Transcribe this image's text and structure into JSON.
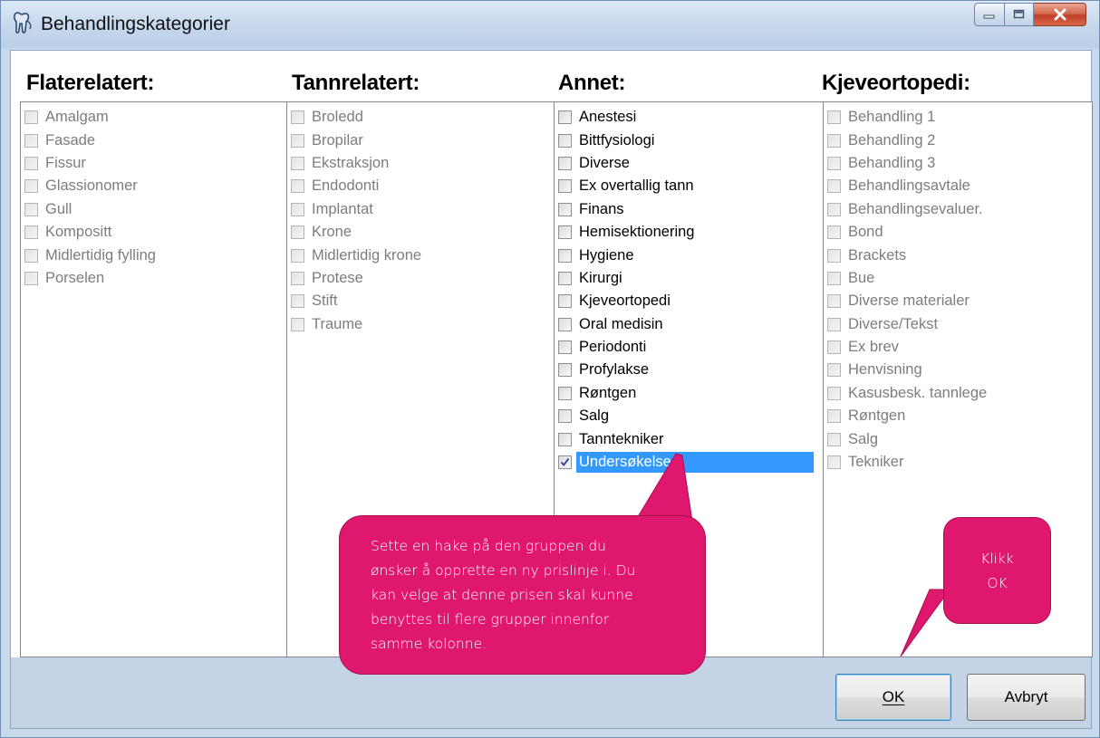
{
  "window": {
    "title": "Behandlingskategorier",
    "min_icon": "minimize-icon",
    "max_icon": "maximize-icon",
    "close_icon": "close-icon"
  },
  "columns": [
    {
      "header": "Flaterelatert:",
      "items": [
        {
          "label": "Amalgam",
          "checked": false,
          "enabled": false
        },
        {
          "label": "Fasade",
          "checked": false,
          "enabled": false
        },
        {
          "label": "Fissur",
          "checked": false,
          "enabled": false
        },
        {
          "label": "Glassionomer",
          "checked": false,
          "enabled": false
        },
        {
          "label": "Gull",
          "checked": false,
          "enabled": false
        },
        {
          "label": "Kompositt",
          "checked": false,
          "enabled": false
        },
        {
          "label": "Midlertidig fylling",
          "checked": false,
          "enabled": false
        },
        {
          "label": "Porselen",
          "checked": false,
          "enabled": false
        }
      ]
    },
    {
      "header": "Tannrelatert:",
      "items": [
        {
          "label": "Broledd",
          "checked": false,
          "enabled": false
        },
        {
          "label": "Bropilar",
          "checked": false,
          "enabled": false
        },
        {
          "label": "Ekstraksjon",
          "checked": false,
          "enabled": false
        },
        {
          "label": "Endodonti",
          "checked": false,
          "enabled": false
        },
        {
          "label": "Implantat",
          "checked": false,
          "enabled": false
        },
        {
          "label": "Krone",
          "checked": false,
          "enabled": false
        },
        {
          "label": "Midlertidig krone",
          "checked": false,
          "enabled": false
        },
        {
          "label": "Protese",
          "checked": false,
          "enabled": false
        },
        {
          "label": "Stift",
          "checked": false,
          "enabled": false
        },
        {
          "label": "Traume",
          "checked": false,
          "enabled": false
        }
      ]
    },
    {
      "header": "Annet:",
      "items": [
        {
          "label": "Anestesi",
          "checked": false,
          "enabled": true
        },
        {
          "label": "Bittfysiologi",
          "checked": false,
          "enabled": true
        },
        {
          "label": "Diverse",
          "checked": false,
          "enabled": true
        },
        {
          "label": "Ex overtallig tann",
          "checked": false,
          "enabled": true
        },
        {
          "label": "Finans",
          "checked": false,
          "enabled": true
        },
        {
          "label": "Hemisektionering",
          "checked": false,
          "enabled": true
        },
        {
          "label": "Hygiene",
          "checked": false,
          "enabled": true
        },
        {
          "label": "Kirurgi",
          "checked": false,
          "enabled": true
        },
        {
          "label": "Kjeveortopedi",
          "checked": false,
          "enabled": true
        },
        {
          "label": "Oral medisin",
          "checked": false,
          "enabled": true
        },
        {
          "label": "Periodonti",
          "checked": false,
          "enabled": true
        },
        {
          "label": "Profylakse",
          "checked": false,
          "enabled": true
        },
        {
          "label": "Røntgen",
          "checked": false,
          "enabled": true
        },
        {
          "label": "Salg",
          "checked": false,
          "enabled": true
        },
        {
          "label": "Tanntekniker",
          "checked": false,
          "enabled": true
        },
        {
          "label": "Undersøkelse",
          "checked": true,
          "enabled": true,
          "selected": true
        }
      ]
    },
    {
      "header": "Kjeveortopedi:",
      "items": [
        {
          "label": "Behandling 1",
          "checked": false,
          "enabled": false
        },
        {
          "label": "Behandling 2",
          "checked": false,
          "enabled": false
        },
        {
          "label": "Behandling 3",
          "checked": false,
          "enabled": false
        },
        {
          "label": "Behandlingsavtale",
          "checked": false,
          "enabled": false
        },
        {
          "label": "Behandlingsevaluer.",
          "checked": false,
          "enabled": false
        },
        {
          "label": "Bond",
          "checked": false,
          "enabled": false
        },
        {
          "label": "Brackets",
          "checked": false,
          "enabled": false
        },
        {
          "label": "Bue",
          "checked": false,
          "enabled": false
        },
        {
          "label": "Diverse materialer",
          "checked": false,
          "enabled": false
        },
        {
          "label": "Diverse/Tekst",
          "checked": false,
          "enabled": false
        },
        {
          "label": "Ex brev",
          "checked": false,
          "enabled": false
        },
        {
          "label": "Henvisning",
          "checked": false,
          "enabled": false
        },
        {
          "label": "Kasusbesk. tannlege",
          "checked": false,
          "enabled": false
        },
        {
          "label": "Røntgen",
          "checked": false,
          "enabled": false
        },
        {
          "label": "Salg",
          "checked": false,
          "enabled": false
        },
        {
          "label": "Tekniker",
          "checked": false,
          "enabled": false
        }
      ]
    }
  ],
  "buttons": {
    "ok_label": "OK",
    "cancel_label": "Avbryt"
  },
  "callouts": {
    "instruction_lines": [
      "Sette en hake på den gruppen du",
      "ønsker å opprette en ny prislinje i. Du",
      "kan velge at denne prisen skal kunne",
      "benyttes til flere grupper innenfor",
      "samme kolonne."
    ],
    "click_lines": [
      "Klikk",
      "OK"
    ]
  },
  "colors": {
    "callout": "#e0176f",
    "selection": "#3399ff",
    "disabled_text": "#7d7d7d"
  }
}
